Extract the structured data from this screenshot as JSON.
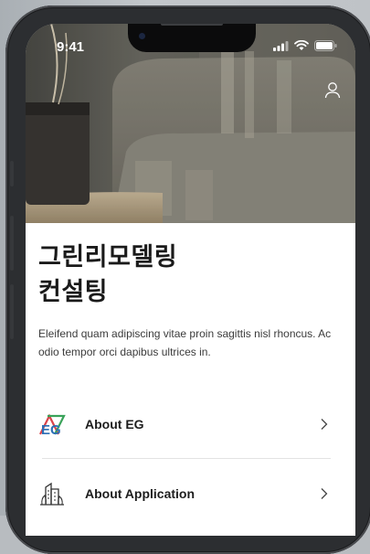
{
  "status_bar": {
    "time": "9:41"
  },
  "header": {
    "title_line1": "그린리모델링",
    "title_line2": "컨설팅"
  },
  "description": "Eleifend quam adipiscing vitae proin sagittis nisl rhoncus. Ac odio tempor orci dapibus ultrices in.",
  "menu": {
    "items": [
      {
        "label": "About EG",
        "icon": "eg-logo-icon",
        "logo_text": "EG"
      },
      {
        "label": "About Application",
        "icon": "building-icon"
      }
    ]
  },
  "colors": {
    "logo_blue": "#2c6fb6",
    "logo_red": "#d9434b",
    "logo_green": "#3aa35a"
  }
}
